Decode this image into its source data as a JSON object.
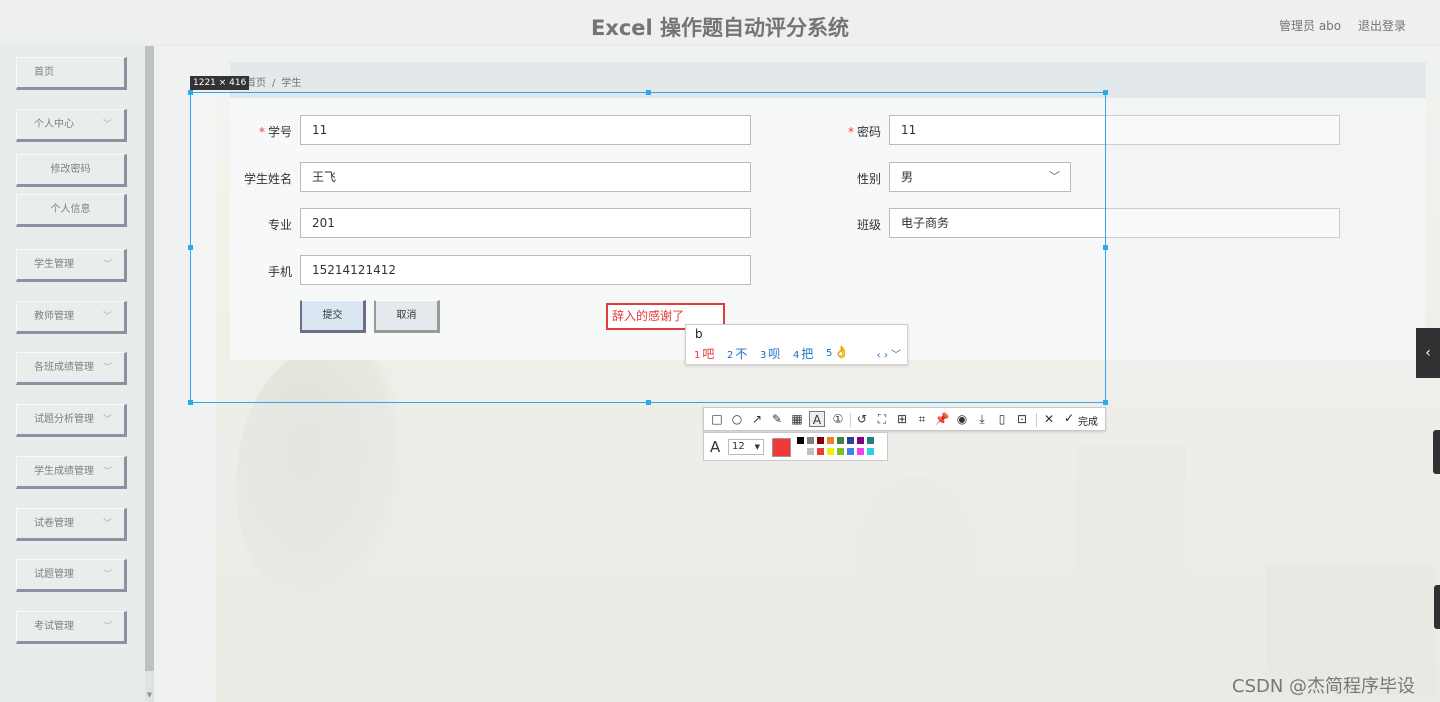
{
  "header": {
    "title": "Excel 操作题自动评分系统",
    "admin": "管理员 abo",
    "logout": "退出登录"
  },
  "sidebar": {
    "items": [
      {
        "label": "首页"
      },
      {
        "label": "个人中心"
      },
      {
        "label": "修改密码"
      },
      {
        "label": "个人信息"
      },
      {
        "label": "学生管理"
      },
      {
        "label": "教师管理"
      },
      {
        "label": "各班成绩管理"
      },
      {
        "label": "试题分析管理"
      },
      {
        "label": "学生成绩管理"
      },
      {
        "label": "试卷管理"
      },
      {
        "label": "试题管理"
      },
      {
        "label": "考试管理"
      }
    ]
  },
  "breadcrumb": {
    "home": "首页",
    "separator": "/",
    "current": "学生"
  },
  "form": {
    "student_no": {
      "label": "学号",
      "value": "11"
    },
    "password": {
      "label": "密码",
      "value": "11"
    },
    "name": {
      "label": "学生姓名",
      "value": "王飞"
    },
    "gender": {
      "label": "性别",
      "value": "男"
    },
    "major": {
      "label": "专业",
      "value": "201"
    },
    "class": {
      "label": "班级",
      "value": "电子商务"
    },
    "phone": {
      "label": "手机",
      "value": "15214121412"
    },
    "submit_label": "提交",
    "cancel_label": "取消",
    "required_mark": "*"
  },
  "capture": {
    "size_label": "1221 × 416",
    "note_text": "辞入的感谢了",
    "ime": {
      "pinyin": "b",
      "candidates": [
        {
          "n": "1",
          "text": "吧"
        },
        {
          "n": "2",
          "text": "不"
        },
        {
          "n": "3",
          "text": "呗"
        },
        {
          "n": "4",
          "text": "把"
        },
        {
          "n": "5",
          "text": "👌"
        }
      ]
    },
    "toolbar": {
      "tools": [
        "rect-icon",
        "ellipse-icon",
        "arrow-icon",
        "pen-icon",
        "mosaic-icon",
        "text-icon",
        "number-icon",
        "undo-icon",
        "ocr-icon",
        "translate-icon",
        "scroll-capture-icon",
        "pin-icon",
        "record-icon",
        "save-icon",
        "phone-icon",
        "bookmark-icon",
        "close-icon"
      ],
      "done_label": "完成",
      "font_size": "12",
      "current_color": "#f03a3a",
      "palette": [
        "#000000",
        "#808080",
        "#800000",
        "#f08030",
        "#408040",
        "#304090",
        "#800080",
        "#208080",
        "#ffffff",
        "#c0c0c0",
        "#f03a3a",
        "#f0f000",
        "#80c020",
        "#4080f0",
        "#f040f0",
        "#30d0e0"
      ]
    }
  },
  "watermark": "CSDN @杰简程序毕设"
}
